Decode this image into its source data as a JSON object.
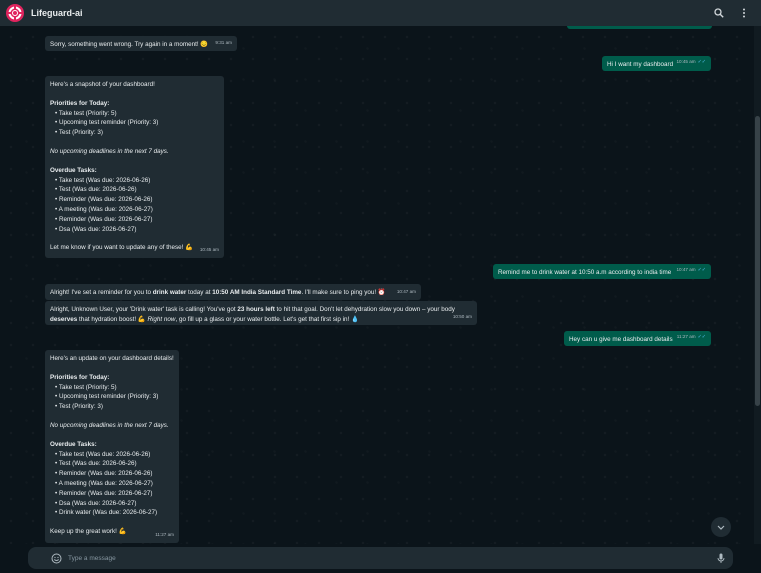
{
  "app": {
    "title": "Lifeguard-ai"
  },
  "input": {
    "placeholder": "Type a message"
  },
  "colors": {
    "header": "#202c33",
    "incoming": "#202c33",
    "outgoing": "#005c4b",
    "background": "#0b141a",
    "tick": "#53bdeb"
  },
  "icons": {
    "search": "search-icon",
    "menu": "more-vertical-icon",
    "attach": "paperclip-icon",
    "emoji": "emoji-icon",
    "mic": "microphone-icon",
    "scroll": "chevron-down-icon"
  },
  "messages": {
    "m1": {
      "text": "Sorry, something went wrong. Try again in a moment! 😔",
      "time": "9:31 am"
    },
    "m2": {
      "text": "Hi I want my dashboard",
      "time": "10:45 am"
    },
    "m3": {
      "intro": "Here's a snapshot of your dashboard!",
      "priorities_title": "Priorities for Today:",
      "priorities": [
        "• Take test (Priority: 5)",
        "• Upcoming test reminder (Priority: 3)",
        "• Test (Priority: 3)"
      ],
      "deadlines": "No upcoming deadlines in the next 7 days.",
      "overdue_title": "Overdue Tasks:",
      "overdue": [
        "• Take test (Was due: 2026-06-26)",
        "• Test (Was due: 2026-06-26)",
        "• Reminder (Was due: 2026-06-26)",
        "• A meeting (Was due: 2026-06-27)",
        "• Reminder (Was due: 2026-06-27)",
        "• Dsa (Was due: 2026-06-27)"
      ],
      "outro": "Let me know if you want to update any of these! 💪",
      "time": "10:45 am"
    },
    "m4": {
      "text": "Remind me to drink water at 10:50 a.m according to india time",
      "time": "10:47 am"
    },
    "m5": {
      "p1": "Alright! I've set a reminder for you to ",
      "b1": "drink water",
      "p2": " today at ",
      "b2": "10:50 AM India Standard Time",
      "p3": ". I'll make sure to ping you! ⏰",
      "time": "10:47 am"
    },
    "m6": {
      "p1": "Alright, Unknown User, your 'Drink water' task is calling! You've got ",
      "b1": "23 hours left",
      "p2": " to hit that goal. Don't let dehydration slow you down – your body ",
      "b2": "deserves",
      "p3": " that hydration boost! 💪 ",
      "i1": "Right now",
      "p4": ", go fill up a glass or your water bottle. Let's get that first sip in! 💧",
      "time": "10:50 am"
    },
    "m7": {
      "text": "Hey can u give me dashboard details",
      "time": "11:27 am"
    },
    "m8": {
      "intro": "Here's an update on your dashboard details!",
      "priorities_title": "Priorities for Today:",
      "priorities": [
        "• Take test (Priority: 5)",
        "• Upcoming test reminder (Priority: 3)",
        "• Test (Priority: 3)"
      ],
      "deadlines": "No upcoming deadlines in the next 7 days.",
      "overdue_title": "Overdue Tasks:",
      "overdue": [
        "• Take test (Was due: 2026-06-26)",
        "• Test (Was due: 2026-06-26)",
        "• Reminder (Was due: 2026-06-26)",
        "• A meeting (Was due: 2026-06-27)",
        "• Reminder (Was due: 2026-06-27)",
        "• Dsa (Was due: 2026-06-27)",
        "• Drink water (Was due: 2026-06-27)"
      ],
      "outro": "Keep up the great work! 💪",
      "time": "11:27 am"
    }
  }
}
